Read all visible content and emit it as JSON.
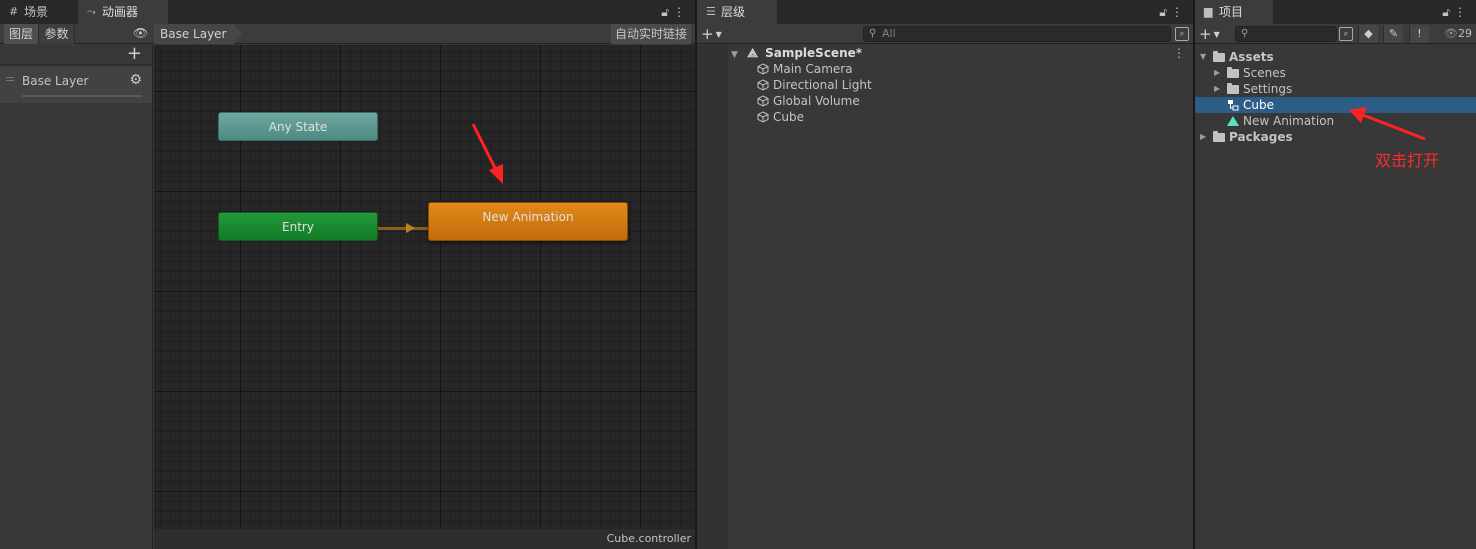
{
  "animator": {
    "tab_scene": "场景",
    "tab_animator": "动画器",
    "tab_layers": "图层",
    "tab_params": "参数",
    "breadcrumb": "Base Layer",
    "auto_live_link": "自动实时链接",
    "layer_name": "Base Layer",
    "nodes": {
      "any_state": "Any State",
      "entry": "Entry",
      "default_state": "New Animation"
    },
    "footer_file": "Cube.controller"
  },
  "hierarchy": {
    "tab_label": "层级",
    "search_placeholder": "All",
    "scene_name": "SampleScene*",
    "items": [
      "Main Camera",
      "Directional Light",
      "Global Volume",
      "Cube"
    ]
  },
  "project": {
    "tab_label": "项目",
    "search_placeholder": "",
    "visible_count": "29",
    "tree": {
      "assets": "Assets",
      "scenes": "Scenes",
      "settings": "Settings",
      "cube": "Cube",
      "new_animation": "New Animation",
      "packages": "Packages"
    }
  },
  "annotation": {
    "text": "双击打开",
    "color": "#ff2a2a"
  },
  "colors": {
    "any_state": "#5e9a92",
    "entry": "#1a8a31",
    "default_state": "#d47a12",
    "selection": "#2c5d87"
  }
}
